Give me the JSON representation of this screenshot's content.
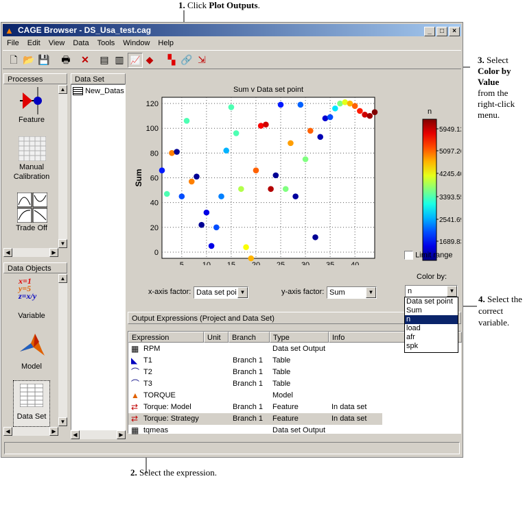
{
  "annotations": {
    "step1_num": "1.",
    "step1_text": "Click",
    "step1_bold": "Plot Outputs",
    "step2_num": "2.",
    "step2_text": "Select the expression.",
    "step3_num": "3.",
    "step3_text1": "Select",
    "step3_bold": "Color by Value",
    "step3_text2": "from the right-click menu.",
    "step4_num": "4.",
    "step4_text": "Select the correct variable."
  },
  "window": {
    "title": "CAGE Browser - DS_Usa_test.cag"
  },
  "menu": [
    "File",
    "Edit",
    "View",
    "Data",
    "Tools",
    "Window",
    "Help"
  ],
  "processes": {
    "title": "Processes",
    "items": [
      {
        "label": "Feature"
      },
      {
        "label": "Manual\nCalibration"
      },
      {
        "label": "Trade Off"
      }
    ]
  },
  "data_objects": {
    "title": "Data Objects",
    "items": [
      {
        "label": "Variable"
      },
      {
        "label": "Model"
      },
      {
        "label": "Data Set"
      }
    ],
    "variable_icon_text": [
      "x=1",
      "y=5",
      "z=x/y"
    ]
  },
  "dataset_panel": {
    "title": "Data Set",
    "item": "New_Datas"
  },
  "chart_data": {
    "type": "scatter",
    "title": "Sum v Data set point",
    "xlabel": "Data set point",
    "ylabel": "Sum",
    "xlim": [
      1,
      44
    ],
    "ylim": [
      -5,
      125
    ],
    "xticks": [
      5,
      10,
      15,
      20,
      25,
      30,
      35,
      40
    ],
    "yticks": [
      0,
      20,
      40,
      60,
      80,
      100,
      120
    ],
    "grid": true,
    "color_by": "n",
    "colorbar": {
      "title": "n",
      "ticks": [
        "5949.12",
        "5097.26",
        "4245.40",
        "3393.55",
        "2541.69",
        "1689.83"
      ]
    },
    "points": [
      [
        1,
        66,
        0.15
      ],
      [
        2,
        47,
        0.45
      ],
      [
        3,
        80,
        0.75
      ],
      [
        4,
        81,
        0.02
      ],
      [
        5,
        45,
        0.2
      ],
      [
        6,
        106,
        0.45
      ],
      [
        7,
        57,
        0.75
      ],
      [
        8,
        61,
        0.02
      ],
      [
        9,
        22,
        0.02
      ],
      [
        10,
        32,
        0.1
      ],
      [
        11,
        5,
        0.1
      ],
      [
        12,
        20,
        0.2
      ],
      [
        13,
        45,
        0.25
      ],
      [
        14,
        82,
        0.3
      ],
      [
        15,
        117,
        0.45
      ],
      [
        16,
        96,
        0.45
      ],
      [
        17,
        51,
        0.55
      ],
      [
        18,
        4,
        0.62
      ],
      [
        19,
        -5,
        0.7
      ],
      [
        20,
        66,
        0.78
      ],
      [
        21,
        102,
        0.88
      ],
      [
        22,
        103,
        0.92
      ],
      [
        23,
        51,
        0.95
      ],
      [
        24,
        62,
        0.02
      ],
      [
        25,
        119,
        0.15
      ],
      [
        26,
        51,
        0.5
      ],
      [
        27,
        88,
        0.72
      ],
      [
        28,
        45,
        0.03
      ],
      [
        29,
        119,
        0.22
      ],
      [
        30,
        75,
        0.5
      ],
      [
        31,
        98,
        0.78
      ],
      [
        32,
        12,
        0.02
      ],
      [
        33,
        93,
        0.05
      ],
      [
        34,
        108,
        0.08
      ],
      [
        35,
        109,
        0.2
      ],
      [
        36,
        116,
        0.35
      ],
      [
        37,
        120,
        0.5
      ],
      [
        38,
        121,
        0.6
      ],
      [
        39,
        120,
        0.7
      ],
      [
        40,
        118,
        0.78
      ],
      [
        41,
        114,
        0.85
      ],
      [
        42,
        111,
        0.92
      ],
      [
        43,
        110,
        0.97
      ],
      [
        44,
        113,
        1.0
      ]
    ]
  },
  "controls": {
    "limit_range": "Limit range",
    "x_factor_label": "x-axis factor:",
    "x_factor_value": "Data set poi",
    "y_factor_label": "y-axis factor:",
    "y_factor_value": "Sum",
    "color_by_label": "Color by:",
    "color_by_value": "n",
    "color_options": [
      "Data set point",
      "Sum",
      "n",
      "load",
      "afr",
      "spk"
    ],
    "color_selected": 2
  },
  "output": {
    "title": "Output Expressions (Project and Data Set)",
    "columns": [
      "Expression",
      "Unit",
      "Branch",
      "Type",
      "Info"
    ],
    "rows": [
      {
        "icon": "table-icon",
        "expr": "RPM",
        "unit": "",
        "branch": "",
        "type": "Data set Output",
        "info": ""
      },
      {
        "icon": "table1d-icon",
        "expr": "T1",
        "unit": "",
        "branch": "Branch 1",
        "type": "Table",
        "info": ""
      },
      {
        "icon": "curve-icon",
        "expr": "T2",
        "unit": "",
        "branch": "Branch 1",
        "type": "Table",
        "info": ""
      },
      {
        "icon": "curve-icon",
        "expr": "T3",
        "unit": "",
        "branch": "Branch 1",
        "type": "Table",
        "info": ""
      },
      {
        "icon": "model-icon",
        "expr": "TORQUE",
        "unit": "",
        "branch": "",
        "type": "Model",
        "info": ""
      },
      {
        "icon": "feature-icon",
        "expr": "Torque: Model",
        "unit": "",
        "branch": "Branch 1",
        "type": "Feature",
        "info": "In data set"
      },
      {
        "icon": "feature-icon",
        "expr": "Torque: Strategy",
        "unit": "",
        "branch": "Branch 1",
        "type": "Feature",
        "info": "In data set"
      },
      {
        "icon": "table-icon",
        "expr": "tqmeas",
        "unit": "",
        "branch": "",
        "type": "Data set Output",
        "info": ""
      }
    ],
    "selected_row": 6
  },
  "colors": {
    "title_bar": "#0a246a",
    "selection": "#0a246a",
    "panel": "#d4d0c8"
  }
}
